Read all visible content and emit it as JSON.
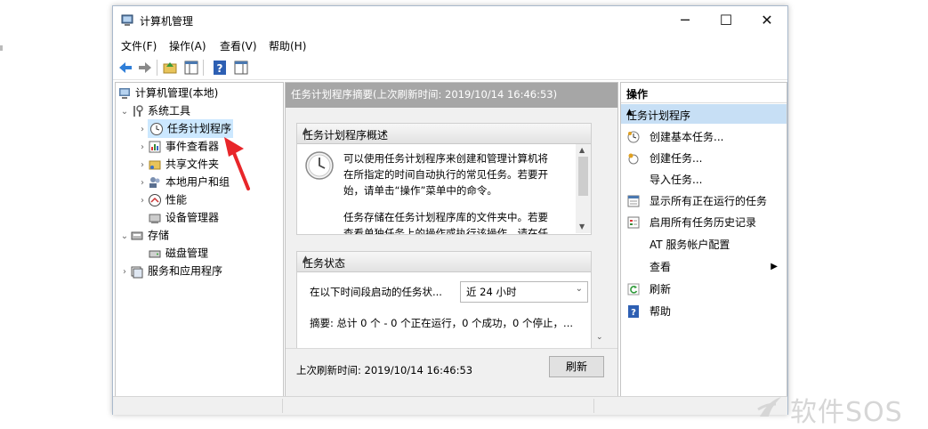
{
  "window": {
    "title": "计算机管理",
    "controls": {
      "minimize": "─",
      "maximize": "☐",
      "close": "✕"
    }
  },
  "menu": [
    "文件(F)",
    "操作(A)",
    "查看(V)",
    "帮助(H)"
  ],
  "tree": [
    {
      "label": "计算机管理(本地)",
      "icon": "computer-management-icon"
    },
    {
      "label": "系统工具",
      "icon": "system-tools-icon",
      "expanded": true
    },
    {
      "label": "任务计划程序",
      "icon": "task-scheduler-clock-icon",
      "selected": true
    },
    {
      "label": "事件查看器",
      "icon": "event-viewer-icon"
    },
    {
      "label": "共享文件夹",
      "icon": "shared-folder-icon"
    },
    {
      "label": "本地用户和组",
      "icon": "users-icon"
    },
    {
      "label": "性能",
      "icon": "performance-icon"
    },
    {
      "label": "设备管理器",
      "icon": "device-manager-icon"
    },
    {
      "label": "存储",
      "icon": "storage-icon",
      "expanded": true
    },
    {
      "label": "磁盘管理",
      "icon": "disk-icon"
    },
    {
      "label": "服务和应用程序",
      "icon": "services-icon"
    }
  ],
  "middle": {
    "header": "任务计划程序摘要(上次刷新时间: 2019/10/14 16:46:53)",
    "overview": {
      "title": "任务计划程序概述",
      "para1": [
        "可以使用任务计划程序来创建和管理计算机将",
        "在所指定的时间自动执行的常见任务。若要开",
        "始，请单击“操作”菜单中的命令。"
      ],
      "para2": [
        "任务存储在任务计划程序库的文件夹中。若要",
        "查看单独任务上的操作或执行该操作，请在任"
      ]
    },
    "status": {
      "title": "任务状态",
      "label": "在以下时间段启动的任务状...",
      "select_value": "近 24 小时",
      "summary": "摘要: 总计 0 个 - 0 个正在运行，0 个成功，0 个停止，..."
    },
    "footer": {
      "last_refresh": "上次刷新时间: 2019/10/14 16:46:53",
      "refresh_button": "刷新"
    }
  },
  "actions": {
    "header": "操作",
    "section": "任务计划程序",
    "items": [
      {
        "label": "创建基本任务...",
        "icon": "create-basic-task-icon"
      },
      {
        "label": "创建任务...",
        "icon": "create-task-icon"
      },
      {
        "label": "导入任务...",
        "icon": ""
      },
      {
        "label": "显示所有正在运行的任务",
        "icon": "running-tasks-icon"
      },
      {
        "label": "启用所有任务历史记录",
        "icon": "history-icon"
      },
      {
        "label": "AT 服务帐户配置",
        "icon": ""
      },
      {
        "label": "查看",
        "icon": "",
        "submenu": "▶"
      },
      {
        "label": "刷新",
        "icon": "refresh-icon"
      },
      {
        "label": "帮助",
        "icon": "help-icon"
      }
    ]
  },
  "watermark": "软件SOS",
  "colors": {
    "selection": "#cce8ff",
    "middle_header": "#a6a6a6",
    "actions_section": "#c7dff5",
    "annotation_arrow": "#e8262a"
  }
}
